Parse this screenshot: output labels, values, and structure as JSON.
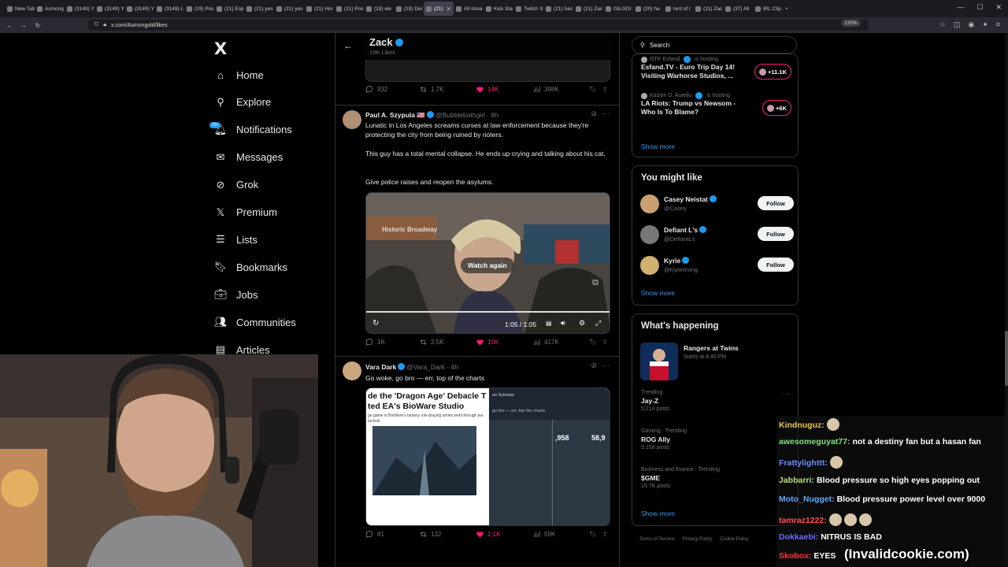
{
  "browser": {
    "tabs": [
      {
        "label": "New Tab",
        "active": false
      },
      {
        "label": "Asmong",
        "active": false
      },
      {
        "label": "(3149) Y",
        "active": false
      },
      {
        "label": "(3149) Y",
        "active": false
      },
      {
        "label": "(3149) Y",
        "active": false
      },
      {
        "label": "(3149) L",
        "active": false
      },
      {
        "label": "(19) Pos",
        "active": false
      },
      {
        "label": "(21) Esp",
        "active": false
      },
      {
        "label": "(21) yes",
        "active": false
      },
      {
        "label": "(21) yes",
        "active": false
      },
      {
        "label": "(21) Hor",
        "active": false
      },
      {
        "label": "(21) Pos",
        "active": false
      },
      {
        "label": "(19) ele",
        "active": false
      },
      {
        "label": "(19) Dei",
        "active": false
      },
      {
        "label": "(21) ",
        "active": true
      },
      {
        "label": "All strea",
        "active": false
      },
      {
        "label": "Kick Sta",
        "active": false
      },
      {
        "label": "Twitch S",
        "active": false
      },
      {
        "label": "(21) has",
        "active": false
      },
      {
        "label": "(21) Zac",
        "active": false
      },
      {
        "label": "GILGOI",
        "active": false
      },
      {
        "label": "(20) ha",
        "active": false
      },
      {
        "label": "lord of t",
        "active": false
      },
      {
        "label": "(21) Zac",
        "active": false
      },
      {
        "label": "(37) All",
        "active": false
      },
      {
        "label": "IRL Clip",
        "active": false
      }
    ],
    "url": "x.com/Asmongold/likes",
    "zoom": "120%"
  },
  "sidebar": {
    "logo": "X",
    "items": [
      {
        "label": "Home",
        "icon": "home-icon"
      },
      {
        "label": "Explore",
        "icon": "search-icon"
      },
      {
        "label": "Notifications",
        "icon": "bell-icon",
        "badge": "20+"
      },
      {
        "label": "Messages",
        "icon": "mail-icon"
      },
      {
        "label": "Grok",
        "icon": "grok-icon"
      },
      {
        "label": "Premium",
        "icon": "x-icon"
      },
      {
        "label": "Lists",
        "icon": "list-icon"
      },
      {
        "label": "Bookmarks",
        "icon": "bookmark-icon"
      },
      {
        "label": "Jobs",
        "icon": "briefcase-icon"
      },
      {
        "label": "Communities",
        "icon": "people-icon"
      },
      {
        "label": "Articles",
        "icon": "article-icon"
      }
    ]
  },
  "header": {
    "name": "Zack",
    "likes": "19K Likes"
  },
  "posts": [
    {
      "actions": {
        "replies": "932",
        "reposts": "1.7K",
        "likes": "14K",
        "views": "398K"
      }
    },
    {
      "author": "Paul A. Szypula 🇺🇸",
      "handle": "@Bubblebathgirl · 8h",
      "text1": "Lunatic in Los Angeles screams curses at law enforcement because they're protecting the city from being ruined by rioters.",
      "text2": "This guy has a total mental collapse. He ends up crying and talking about his cat.",
      "text3": "Give police raises and reopen the asylums.",
      "video": {
        "overlay": "Watch again",
        "time": "1:05 / 1:05",
        "sign": "Historic Broadway"
      },
      "actions": {
        "replies": "1K",
        "reposts": "2.5K",
        "likes": "10K",
        "views": "417K"
      }
    },
    {
      "author": "Vara Dark",
      "handle": "@Vara_Dark · 4h",
      "text": "Go woke, go bro — err, top of the charts",
      "media_left": {
        "headline1": "de the 'Dragon Age' Debacle T",
        "headline2": "ted EA's BioWare Studio",
        "caption": "ge game in BioWare's fantasy role-playing series went through lea",
        "caption2": "turmoil"
      },
      "media_right": {
        "author": "on Schreier",
        "text": "go bro — err, top the charts",
        "num1": ",958",
        "num2": "58,9"
      },
      "actions": {
        "replies": "81",
        "reposts": "132",
        "likes": "2.1K",
        "views": "59K"
      }
    }
  ],
  "right": {
    "search_placeholder": "Search",
    "spaces": [
      {
        "host": "OTK Esfand",
        "hosting": "is hosting",
        "title": "Esfand.TV - Euro Trip Day 14! Visiting Warhorse Studios, ...",
        "count": "+11.1K"
      },
      {
        "host": "Kaizen D. Asiedu",
        "hosting": "is hosting",
        "title": "LA Riots: Trump vs Newsom - Who Is To Blame?",
        "count": "+6K"
      }
    ],
    "spaces_showmore": "Show more",
    "ymL_title": "You might like",
    "suggestions": [
      {
        "name": "Casey Neistat",
        "handle": "@Casey",
        "follow": "Follow"
      },
      {
        "name": "Defiant L's",
        "handle": "@DefiantLs",
        "follow": "Follow"
      },
      {
        "name": "Kyrie",
        "handle": "@KyrieIrving",
        "follow": "Follow"
      }
    ],
    "ymL_showmore": "Show more",
    "happening_title": "What's happening",
    "event": {
      "title": "Rangers at Twins",
      "time": "Starts at 4:40 PM"
    },
    "trends": [
      {
        "category": "Trending",
        "title": "Jay-Z",
        "posts": "5,214 posts"
      },
      {
        "category": "Gaming · Trending",
        "title": "ROG Ally",
        "posts": "5,156 posts"
      },
      {
        "category": "Business and finance · Trending",
        "title": "$GME",
        "posts": "15.7K posts"
      }
    ],
    "happening_showmore": "Show more",
    "footer": [
      "Terms of Service",
      "Privacy Policy",
      "Cookie Policy"
    ]
  },
  "chat": [
    {
      "user": "Kindnuguz:",
      "color": "#e8c547",
      "text": ""
    },
    {
      "user": "awesomeguyat77:",
      "color": "#7ee27e",
      "text": "not a destiny fan but a hasan fan"
    },
    {
      "user": "Frattylighttt:",
      "color": "#6b8cff",
      "text": ""
    },
    {
      "user": "Jabbarri:",
      "color": "#b3e06b",
      "text": "Blood pressure so high eyes popping out"
    },
    {
      "user": "Moto_Nugget:",
      "color": "#5aa9ff",
      "text": "Blood pressure power level over 9000"
    },
    {
      "user": "tamraz1222:",
      "color": "#ff4d4d",
      "text": ""
    },
    {
      "user": "Dokkaebi:",
      "color": "#6b6bff",
      "text": "NITRUS IS BAD"
    },
    {
      "user": "Skobox:",
      "color": "#ff3030",
      "text": "EYES"
    }
  ],
  "watermark": "(Invalidcookie.com)"
}
